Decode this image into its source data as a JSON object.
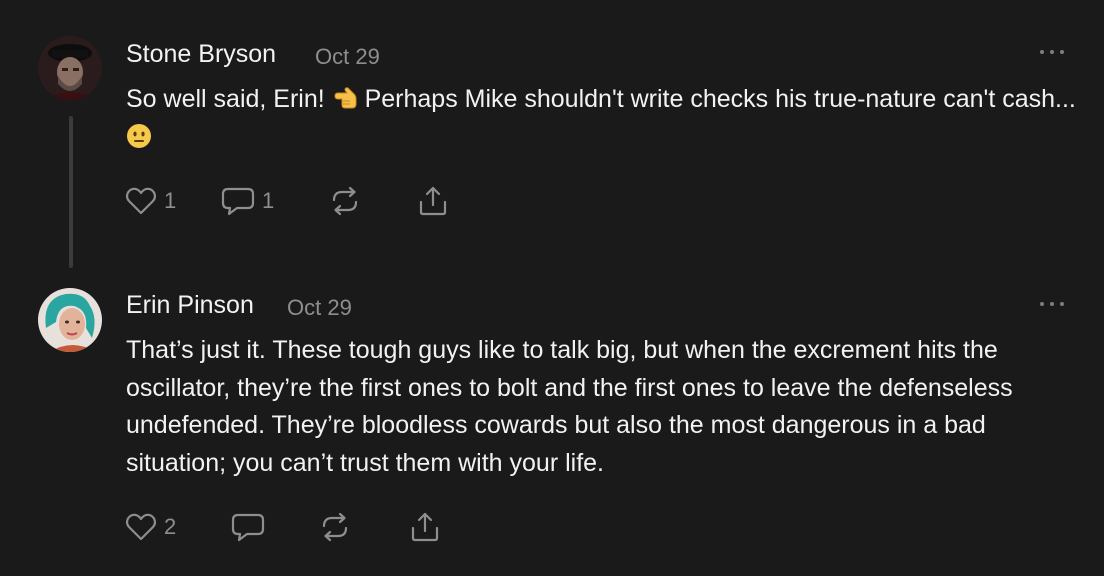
{
  "comments": [
    {
      "author": "Stone Bryson",
      "date": "Oct 29",
      "text_before": "So well said, Erin! ",
      "text_middle": " Perhaps Mike shouldn't write checks his true-nature can't cash... ",
      "emoji_1": "backhand-index-pointing-left",
      "emoji_2": "neutral-face",
      "likes": "1",
      "replies": "1"
    },
    {
      "author": "Erin Pinson",
      "date": "Oct 29",
      "text": "That’s just it. These tough guys like to talk big, but when the excrement hits the oscillator, they’re the first ones to bolt and the first ones to leave the defenseless undefended. They’re bloodless cowards but also the most dangerous in a bad situation; you can’t trust them with your life.",
      "likes": "2"
    }
  ],
  "colors": {
    "background": "#1a1a1a",
    "text": "#f2f2f2",
    "muted": "#8e8e8e",
    "thread_line": "#3b3b3b"
  },
  "icons": {
    "like": "heart-icon",
    "reply": "speech-bubble-icon",
    "restack": "restack-arrows-icon",
    "share": "share-upload-icon",
    "more": "more-dots-icon"
  }
}
